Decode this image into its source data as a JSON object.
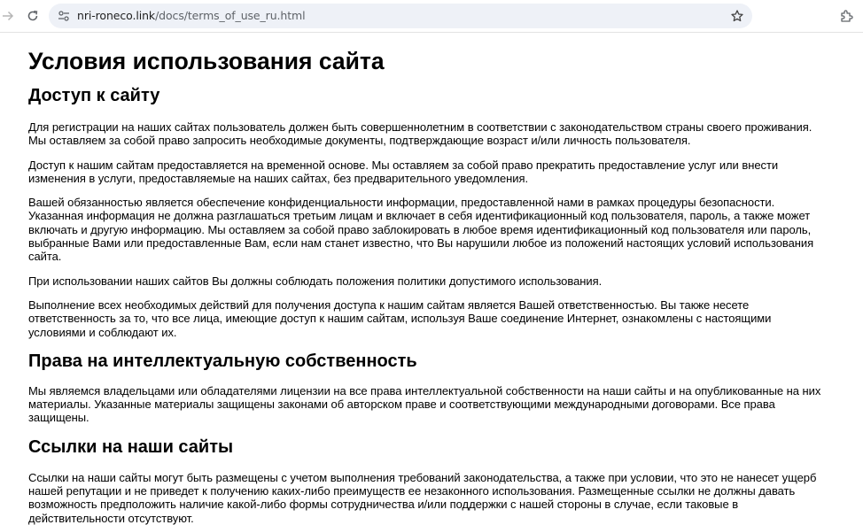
{
  "browser": {
    "url_host": "nri-roneco.link",
    "url_path": "/docs/terms_of_use_ru.html"
  },
  "page": {
    "title": "Условия использования сайта",
    "sections": {
      "access": {
        "heading": "Доступ к сайту",
        "paragraphs": [
          "Для регистрации на наших сайтах пользователь должен быть совершеннолетним в соответствии с законодательством страны своего проживания. Мы оставляем за собой право запросить необходимые документы, подтверждающие возраст и/или личность пользователя.",
          "Доступ к нашим сайтам предоставляется на временной основе. Мы оставляем за собой право прекратить предоставление услуг или внести изменения в услуги, предоставляемые на наших сайтах, без предварительного уведомления.",
          "Вашей обязанностью является обеспечение конфиденциальности информации, предоставленной нами в рамках процедуры безопасности. Указанная информация не должна разглашаться третьим лицам и включает в себя идентификационный код пользователя, пароль, а также может включать и другую информацию. Мы оставляем за собой право заблокировать в любое время идентификационный код пользователя или пароль, выбранные Вами или предоставленные Вам, если нам станет известно, что Вы нарушили любое из положений настоящих условий использования сайта.",
          "При использовании наших сайтов Вы должны соблюдать положения политики допустимого использования.",
          "Выполнение всех необходимых действий для получения доступа к нашим сайтам является Вашей ответственностью. Вы также несете ответственность за то, что все лица, имеющие доступ к нашим сайтам, используя Ваше соединение Интернет, ознакомлены с настоящими условиями и соблюдают их."
        ]
      },
      "intellectual_property": {
        "heading": "Права на интеллектуальную собственность",
        "paragraphs": [
          "Мы являемся владельцами или обладателями лицензии на все права интеллектуальной собственности на наши сайты и на опубликованные на них материалы. Указанные материалы защищены законами об авторском праве и соответствующими международными договорами. Все права защищены."
        ]
      },
      "links": {
        "heading": "Ссылки на наши сайты",
        "paragraphs": [
          "Ссылки на наши сайты могут быть размещены с учетом выполнения требований законодательства, а также при условии, что это не нанесет ущерб нашей репутации и не приведет к получению каких-либо преимуществ ее незаконного использования. Размещенные ссылки не должны давать возможность предположить наличие какой-либо формы сотрудничества и/или поддержки с нашей стороны в случае, если таковые в действительности отсутствуют."
        ]
      }
    }
  }
}
